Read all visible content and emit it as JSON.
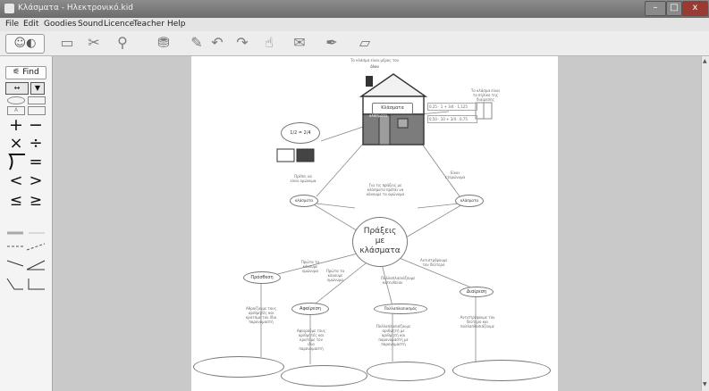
{
  "window": {
    "title": "Κλάσματα - Ηλεκτρονικό.kid",
    "controls": [
      "–",
      "□",
      "x"
    ]
  },
  "menu": [
    "File",
    "Edit",
    "Goodies",
    "Sound",
    "Licence",
    "Teacher",
    "Help"
  ],
  "toolbar_icons": [
    "picture-frame-icon",
    "scissors-icon",
    "magnifier-icon",
    "paint-bucket-icon",
    "pencil-icon",
    "undo-icon",
    "redo-icon",
    "hand-icon",
    "envelope-icon",
    "pen-icon",
    "book-icon"
  ],
  "palette": {
    "find_label": "Find",
    "button_a": "A",
    "symbols": [
      "+",
      "−",
      "×",
      "÷",
      "=",
      "<",
      ">",
      "≤",
      "≥"
    ]
  },
  "map": {
    "top_caption": "Το κλάσμα είναι μέρος του",
    "top_caption_2": "όλου",
    "house_label": "Κλάσματα",
    "house_small": "κλάσματα",
    "right_note": "Το κλάσμα είναι το πηλίκο της διαίρεσης",
    "eq1": "0.25 · 1 + 3/4 · 1,125",
    "eq2": "0,50 · 10 + 3/4 · 0,75",
    "frac_left": "1/2 = 2/4",
    "center_line1": "Πράξεις",
    "center_line2": "με",
    "center_line3": "κλάσματα",
    "left_node": "κλάσματα",
    "right_node": "κλάσματα",
    "mid_text": "Για τις πράξεις με κλάσματα πρέπει να κάνουμε τα ομώνυμα",
    "left_edge_text": "Πρέπει να είναι ομώνυμα",
    "right_edge_text": "Είναι ετερώνυμα",
    "op_add": "Πρόσθεση",
    "op_sub": "Αφαίρεση",
    "op_mul": "Πολλαπλασιασμός",
    "op_div": "Διαίρεση",
    "note_add": "Αθροίζουμε τους αριθμητές και κρατάμε τον ίδιο παρονομαστή",
    "note_sub": "Αφαιρούμε τους αριθμητές και κρατάμε τον ίδιο παρονομαστή",
    "note_mul": "Πολλαπλασιάζουμε αριθμητή με αριθμητή και παρονομαστή με παρονομαστή",
    "note_div": "Αντιστρέφουμε τον δεύτερο και πολλαπλασιάζουμε",
    "edge_add": "Πρώτα τα κάνουμε ομώνυμα",
    "edge_sub": "Πρώτα τα κάνουμε ομώνυμα",
    "edge_mul": "Πολλαπλασιάζουμε κατευθείαν",
    "edge_div": "Αντιστρέφουμε τον δεύτερο"
  }
}
